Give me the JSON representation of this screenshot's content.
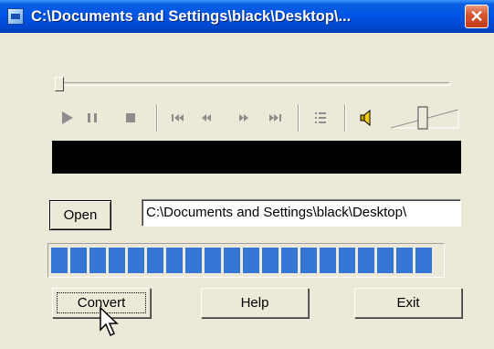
{
  "window": {
    "title": "C:\\Documents and Settings\\black\\Desktop\\...",
    "close_glyph": "✕"
  },
  "player": {
    "seek_position": 0,
    "volume_level": 0.6,
    "transport_icons": [
      "play-icon",
      "pause-icon",
      "stop-icon",
      "skip-back-icon",
      "rewind-icon",
      "fast-forward-icon",
      "skip-forward-icon",
      "playlist-icon",
      "speaker-icon"
    ]
  },
  "file": {
    "open_label": "Open",
    "path_value": "C:\\Documents and Settings\\black\\Desktop\\"
  },
  "progress": {
    "segments": 20,
    "fraction": 1.0,
    "color": "#3476d3"
  },
  "actions": {
    "convert_label": "Convert",
    "help_label": "Help",
    "exit_label": "Exit"
  },
  "colors": {
    "titlebar": "#0055e5",
    "dialog_bg": "#ece9d8",
    "close_red": "#d8562f"
  }
}
